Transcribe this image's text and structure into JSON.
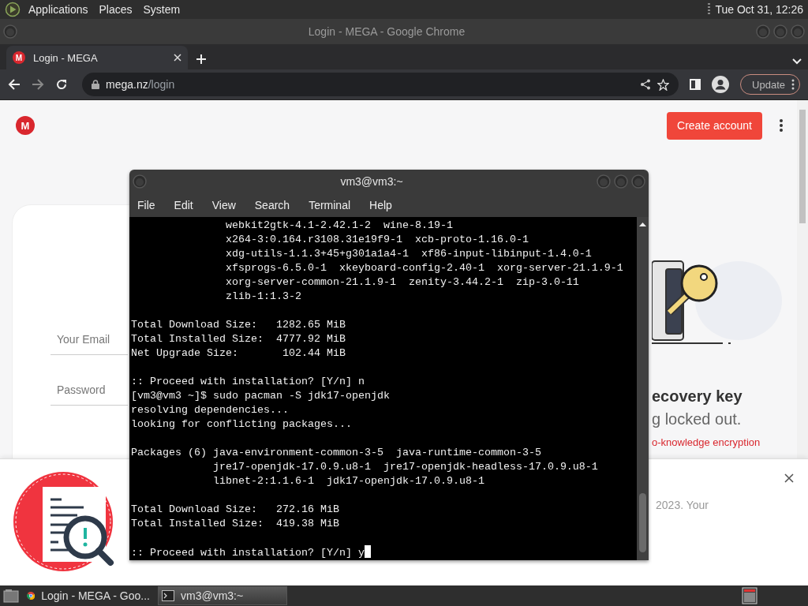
{
  "top_panel": {
    "menus": [
      "Applications",
      "Places",
      "System"
    ],
    "clock": "Tue Oct 31, 12:26"
  },
  "browser": {
    "title": "Login - MEGA - Google Chrome",
    "tabs": [
      {
        "label": "Login - MEGA",
        "favicon_letter": "M",
        "selected": true
      }
    ],
    "address": {
      "host": "mega.nz",
      "path": "/login"
    },
    "update_button": "Update",
    "page": {
      "logo_letter": "M",
      "create_account": "Create account",
      "email_placeholder": "Your Email",
      "password_placeholder": "Password",
      "heading": "ecovery key",
      "subtitle": "g locked out.",
      "link": "o-knowledge encryption",
      "banner_text": "2023. Your"
    }
  },
  "terminal": {
    "title": "vm3@vm3:~",
    "menus": [
      "File",
      "Edit",
      "View",
      "Search",
      "Terminal",
      "Help"
    ],
    "blocks": [
      [
        "               webkit2gtk-4.1-2.42.1-2  wine-8.19-1",
        "               x264-3:0.164.r3108.31e19f9-1  xcb-proto-1.16.0-1",
        "               xdg-utils-1.1.3+45+g301a1a4-1  xf86-input-libinput-1.4.0-1",
        "               xfsprogs-6.5.0-1  xkeyboard-config-2.40-1  xorg-server-21.1.9-1",
        "               xorg-server-common-21.1.9-1  zenity-3.44.2-1  zip-3.0-11",
        "               zlib-1:1.3-2"
      ],
      [
        "Total Download Size:   1282.65 MiB",
        "Total Installed Size:  4777.92 MiB",
        "Net Upgrade Size:       102.44 MiB"
      ],
      [
        ":: Proceed with installation? [Y/n] n",
        "[vm3@vm3 ~]$ sudo pacman -S jdk17-openjdk",
        "resolving dependencies...",
        "looking for conflicting packages..."
      ],
      [
        "Packages (6) java-environment-common-3-5  java-runtime-common-3-5",
        "             jre17-openjdk-17.0.9.u8-1  jre17-openjdk-headless-17.0.9.u8-1",
        "             libnet-2:1.1.6-1  jdk17-openjdk-17.0.9.u8-1"
      ],
      [
        "Total Download Size:   272.16 MiB",
        "Total Installed Size:  419.38 MiB"
      ],
      [
        ":: Proceed with installation? [Y/n] y"
      ]
    ],
    "cursor": true
  },
  "taskbar": {
    "items": [
      {
        "label": "Login - MEGA - Goo...",
        "kind": "browser",
        "selected": false
      },
      {
        "label": "vm3@vm3:~",
        "kind": "terminal",
        "selected": true
      }
    ]
  }
}
